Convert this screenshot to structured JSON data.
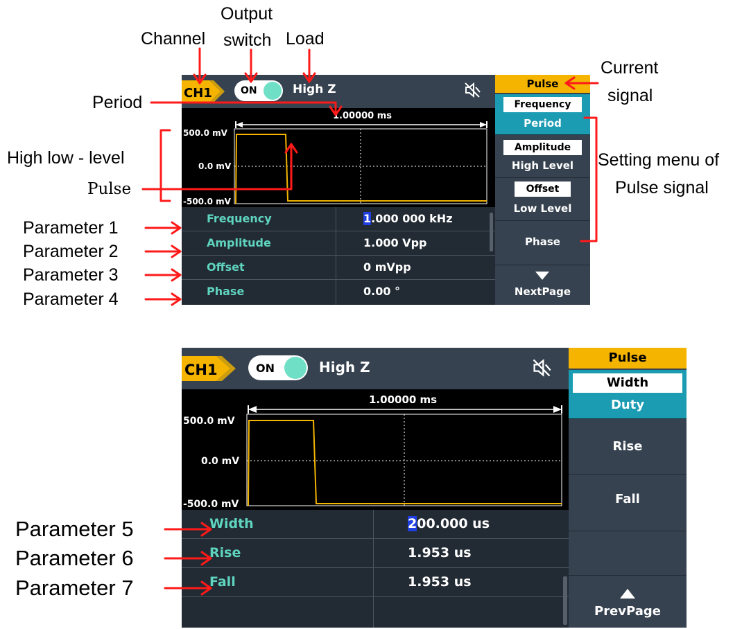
{
  "annotations": {
    "channel": "Channel",
    "output_switch_line1": "Output",
    "output_switch_line2": "switch",
    "load": "Load",
    "current_signal_line1": "Current",
    "current_signal_line2": "signal",
    "period": "Period",
    "high_low_level": "High low - level",
    "pulse": "Pulse",
    "setting_menu_line1": "Setting menu of",
    "setting_menu_line2": "Pulse signal",
    "param1": "Parameter 1",
    "param2": "Parameter 2",
    "param3": "Parameter 3",
    "param4": "Parameter 4",
    "param5": "Parameter 5",
    "param6": "Parameter 6",
    "param7": "Parameter 7"
  },
  "screen1": {
    "channel_badge": "CH1",
    "switch_label": "ON",
    "load": "High Z",
    "period_label": "1.00000 ms",
    "y_labels": [
      "500.0 mV",
      "0.0 mV",
      "-500.0 mV"
    ],
    "params": [
      {
        "name": "Frequency",
        "value_first": "1",
        "value_rest": ".000 000 kHz"
      },
      {
        "name": "Amplitude",
        "value_first": "",
        "value_rest": "1.000 Vpp"
      },
      {
        "name": "Offset",
        "value_first": "",
        "value_rest": "0 mVpp"
      },
      {
        "name": "Phase",
        "value_first": "",
        "value_rest": "0.00 °"
      }
    ],
    "menu": {
      "title": "Pulse",
      "items": [
        {
          "box": "Frequency",
          "text": "Period",
          "selected": true
        },
        {
          "box": "Amplitude",
          "text": "High Level",
          "selected": false
        },
        {
          "box": "Offset",
          "text": "Low Level",
          "selected": false
        },
        {
          "box": "",
          "text": "Phase",
          "selected": false
        },
        {
          "box": "",
          "text": "NextPage",
          "selected": false
        }
      ]
    }
  },
  "screen2": {
    "channel_badge": "CH1",
    "switch_label": "ON",
    "load": "High Z",
    "period_label": "1.00000 ms",
    "y_labels": [
      "500.0 mV",
      "0.0 mV",
      "-500.0 mV"
    ],
    "params": [
      {
        "name": "Width",
        "value_first": "2",
        "value_rest": "00.000 us"
      },
      {
        "name": "Rise",
        "value_first": "",
        "value_rest": "1.953 us"
      },
      {
        "name": "Fall",
        "value_first": "",
        "value_rest": "1.953 us"
      },
      {
        "name": "",
        "value_first": "",
        "value_rest": ""
      }
    ],
    "menu": {
      "title": "Pulse",
      "items": [
        {
          "box": "Width",
          "text": "Duty",
          "selected": true
        },
        {
          "box": "",
          "text": "Rise",
          "selected": false
        },
        {
          "box": "",
          "text": "Fall",
          "selected": false
        },
        {
          "box": "",
          "text": "",
          "selected": false
        },
        {
          "box": "",
          "text": "PrevPage",
          "selected": false
        }
      ]
    }
  },
  "colors": {
    "accent_teal": "#5fd5c0",
    "menu_header": "#f4b400",
    "selected_menu": "#1b9cb2",
    "waveform": "#f4b400",
    "annotation_arrow": "#ff1a1a"
  }
}
